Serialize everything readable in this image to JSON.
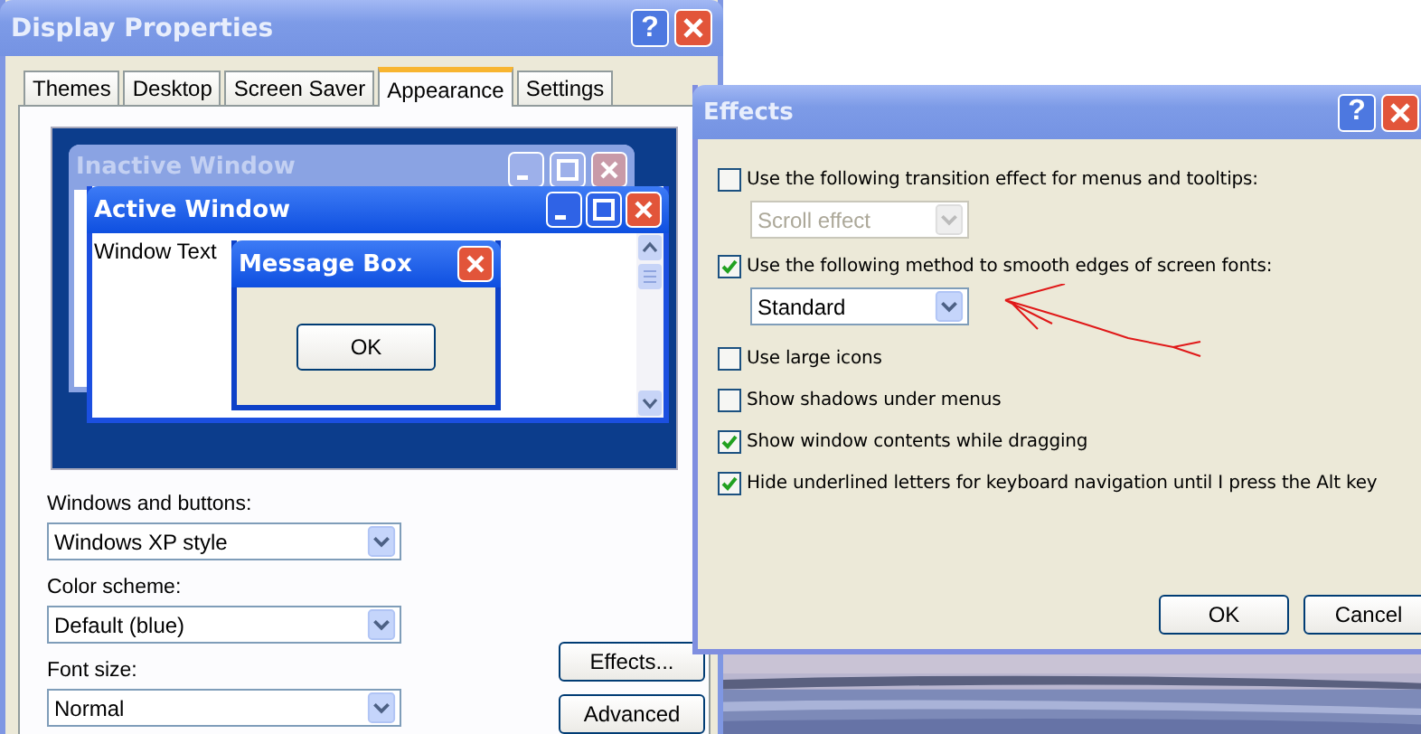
{
  "display_properties": {
    "title": "Display Properties",
    "help": "?",
    "tabs": [
      {
        "label": "Themes",
        "selected": false
      },
      {
        "label": "Desktop",
        "selected": false
      },
      {
        "label": "Screen Saver",
        "selected": false
      },
      {
        "label": "Appearance",
        "selected": true
      },
      {
        "label": "Settings",
        "selected": false
      }
    ],
    "preview": {
      "inactive_title": "Inactive Window",
      "active_title": "Active Window",
      "window_text": "Window Text",
      "message_box_title": "Message Box",
      "message_button": "OK"
    },
    "fields": [
      {
        "label": "Windows and buttons:",
        "value": "Windows XP style"
      },
      {
        "label": "Color scheme:",
        "value": "Default (blue)"
      },
      {
        "label": "Font size:",
        "value": "Normal"
      }
    ],
    "buttons": [
      "Effects...",
      "Advanced"
    ]
  },
  "effects": {
    "title": "Effects",
    "help": "?",
    "options": [
      {
        "kind": "checkbox",
        "label": "Use the following transition effect for menus and tooltips:",
        "checked": false
      },
      {
        "kind": "dropdown",
        "value": "Scroll effect",
        "disabled": true
      },
      {
        "kind": "checkbox",
        "label": "Use the following method to smooth edges of screen fonts:",
        "checked": true
      },
      {
        "kind": "dropdown",
        "value": "Standard",
        "disabled": false
      },
      {
        "kind": "checkbox",
        "label": "Use large icons",
        "checked": false
      },
      {
        "kind": "checkbox",
        "label": "Show shadows under menus",
        "checked": false
      },
      {
        "kind": "checkbox",
        "label": "Show window contents while dragging",
        "checked": true
      },
      {
        "kind": "checkbox",
        "label": "Hide underlined letters for keyboard navigation until I press the Alt key",
        "checked": true
      }
    ],
    "buttons": [
      "OK",
      "Cancel"
    ]
  }
}
